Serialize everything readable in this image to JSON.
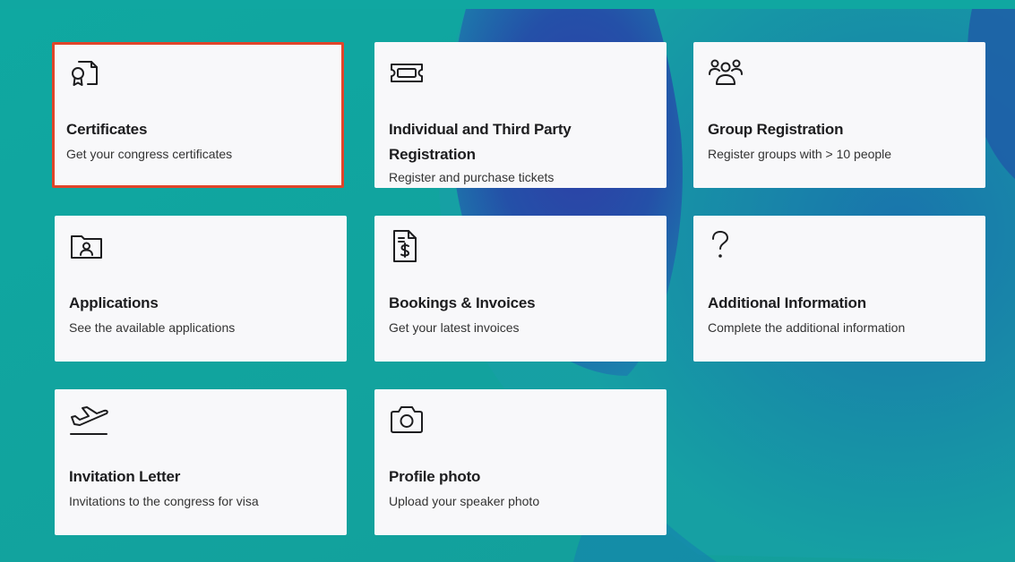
{
  "cards": [
    {
      "title": "Certificates",
      "description": "Get your congress certificates",
      "icon": "certificate-icon",
      "selected": true
    },
    {
      "title": "Individual and Third Party Registration",
      "description": "Register and purchase tickets",
      "icon": "ticket-icon"
    },
    {
      "title": "Group Registration",
      "description": "Register groups with > 10 people",
      "icon": "group-icon"
    },
    {
      "title": "Applications",
      "description": "See the available applications",
      "icon": "user-folder-icon"
    },
    {
      "title": "Bookings & Invoices",
      "description": "Get your latest invoices",
      "icon": "invoice-icon"
    },
    {
      "title": "Additional Information",
      "description": "Complete the additional information",
      "icon": "question-icon"
    },
    {
      "title": "Invitation Letter",
      "description": "Invitations to the congress for visa",
      "icon": "plane-takeoff-icon"
    },
    {
      "title": "Profile photo",
      "description": "Upload your speaker photo",
      "icon": "camera-icon"
    }
  ],
  "colors": {
    "background": "#139f9c",
    "card": "#f8f8fa",
    "selected_border": "#e0452a",
    "text": "#1d1d1f"
  }
}
